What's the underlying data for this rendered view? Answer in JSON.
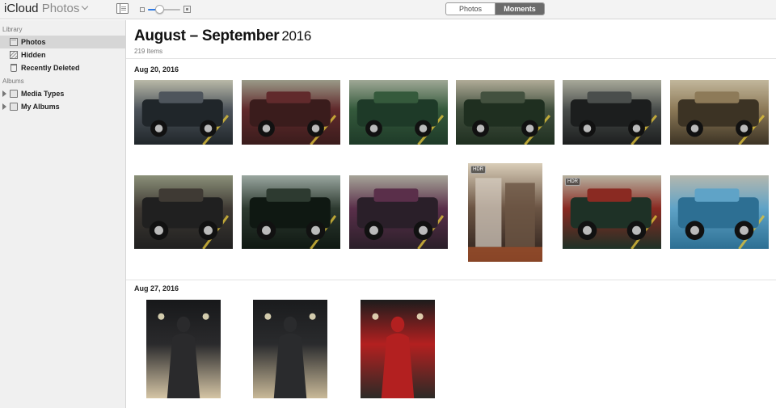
{
  "app": {
    "title_brand": "iCloud",
    "title_section": "Photos"
  },
  "toolbar": {
    "zoom_fraction": 0.4,
    "segments": [
      {
        "label": "Photos",
        "active": false
      },
      {
        "label": "Moments",
        "active": true
      }
    ]
  },
  "sidebar": {
    "library_heading": "Library",
    "albums_heading": "Albums",
    "items": [
      {
        "label": "Photos",
        "icon": "photos-icon",
        "selected": true
      },
      {
        "label": "Hidden",
        "icon": "hidden-icon",
        "selected": false
      },
      {
        "label": "Recently Deleted",
        "icon": "trash-icon",
        "selected": false
      }
    ],
    "albums": [
      {
        "label": "Media Types",
        "icon": "folder-icon"
      },
      {
        "label": "My Albums",
        "icon": "folder-icon"
      }
    ]
  },
  "main": {
    "title_range": "August – September",
    "title_year": "2016",
    "item_count": "219 Items",
    "moments": [
      {
        "date": "Aug 20, 2016",
        "photos": [
          {
            "subject": "car-engine-bay",
            "colors": [
              "#20262a",
              "#4e555c",
              "#b9b9a8"
            ],
            "hdr": false
          },
          {
            "subject": "vintage-taxi",
            "colors": [
              "#3a1c1c",
              "#612a2c",
              "#9a9a88"
            ],
            "hdr": false
          },
          {
            "subject": "green-hotrod",
            "colors": [
              "#1e3a28",
              "#355a3c",
              "#9fa896"
            ],
            "hdr": false
          },
          {
            "subject": "green-t-bucket",
            "colors": [
              "#1f2f20",
              "#43513f",
              "#b1ac98"
            ],
            "hdr": false
          },
          {
            "subject": "black-t-bucket",
            "colors": [
              "#1c1e1e",
              "#4a4e4c",
              "#a8a99a"
            ],
            "hdr": false
          },
          {
            "subject": "model-a-roadster",
            "colors": [
              "#3c3324",
              "#8d7a58",
              "#c2b79c"
            ],
            "hdr": false
          },
          {
            "subject": "black-hotrod",
            "colors": [
              "#202020",
              "#3f3a34",
              "#8b9079"
            ],
            "hdr": false
          },
          {
            "subject": "police-interceptor",
            "colors": [
              "#0f1812",
              "#2d3a30",
              "#9aa7a0"
            ],
            "hdr": false
          },
          {
            "subject": "rat-rod-trailer",
            "colors": [
              "#2a1f29",
              "#5a2f4a",
              "#a6a498"
            ],
            "hdr": false
          },
          {
            "subject": "halloween-props",
            "colors": [
              "#2a1e1a",
              "#6c5544",
              "#d9cdb8"
            ],
            "hdr": true
          },
          {
            "subject": "green-roadster-interior",
            "colors": [
              "#1e3126",
              "#8a2a22",
              "#b7b2a0"
            ],
            "hdr": true
          },
          {
            "subject": "blue-corvette",
            "colors": [
              "#2d6f93",
              "#5fa3c7",
              "#b4b7ae"
            ],
            "hdr": false
          }
        ]
      },
      {
        "date": "Aug 27, 2016",
        "photos": [
          {
            "subject": "borg-costume-front",
            "colors": [
              "#d5c5a5",
              "#2a2a2c",
              "#17181a"
            ],
            "hdr": false
          },
          {
            "subject": "borg-costume-side",
            "colors": [
              "#c9b998",
              "#2a2b2d",
              "#1a1b1d"
            ],
            "hdr": false
          },
          {
            "subject": "red-cloak-costume",
            "colors": [
              "#2c2a26",
              "#b32020",
              "#1c1c1c"
            ],
            "hdr": false
          }
        ]
      }
    ]
  }
}
